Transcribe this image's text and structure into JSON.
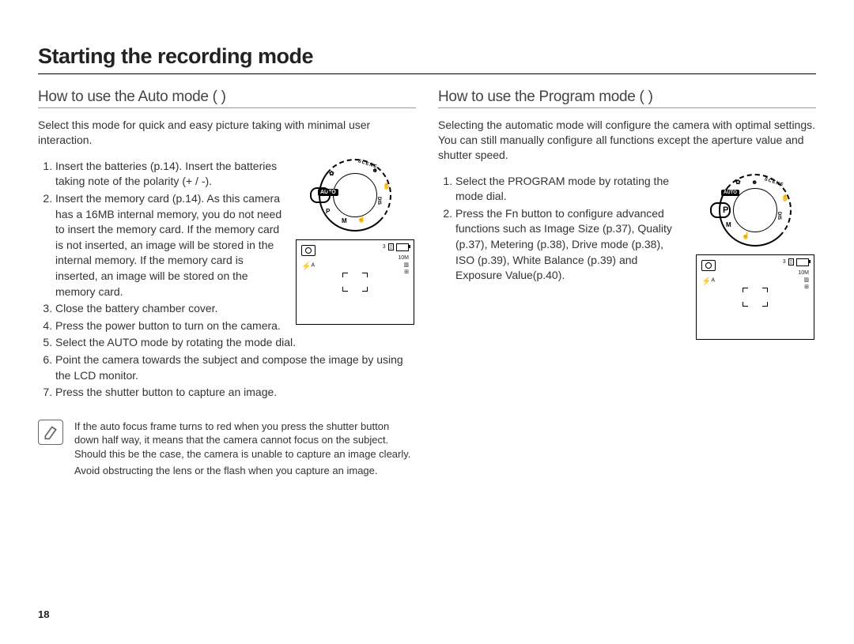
{
  "title": "Starting the recording mode",
  "page_number": "18",
  "left": {
    "heading": "How to use the Auto mode (          )",
    "intro": "Select this mode for quick and easy picture taking with minimal user interaction.",
    "steps": [
      "Insert the batteries (p.14). Insert the batteries taking note of the polarity (+ / -).",
      "Insert the memory card (p.14). As this camera has a 16MB internal memory, you do not need to insert the memory card. If the memory card is not inserted, an image will be stored in the internal memory. If the memory card is inserted, an image will be stored on the memory card.",
      "Close the battery chamber cover.",
      "Press the power button to turn on the camera.",
      "Select the AUTO mode by rotating the mode dial.",
      "Point the camera towards the subject and compose the image by using the LCD monitor.",
      "Press the shutter button to capture an image."
    ],
    "dial_selected": "AUTO",
    "dial_labels": {
      "scene": "SCENE",
      "p": "P",
      "m": "M",
      "dis": "DIS"
    },
    "lcd": {
      "top_right_count": "3",
      "resolution": "10M",
      "flash_auto": "⚡ᴬ"
    },
    "note": [
      "If the auto focus frame turns to red when you press the shutter button down half way, it means that the camera cannot focus on the subject. Should this be the case, the camera is unable to capture an image clearly.",
      "Avoid obstructing the lens or the ﬂash when you capture an image."
    ]
  },
  "right": {
    "heading": "How to use the Program mode (     )",
    "intro": "Selecting the automatic mode will conﬁgure the camera with optimal settings. You can still manually conﬁgure all functions except the aperture value and shutter speed.",
    "steps": [
      "Select the PROGRAM mode by rotating the mode dial.",
      "Press the Fn button to conﬁgure advanced functions such as Image Size (p.37), Quality (p.37), Metering (p.38), Drive mode (p.38), ISO (p.39), White Balance (p.39) and Exposure Value(p.40)."
    ],
    "dial_selected": "P",
    "dial_labels": {
      "scene": "SCENE",
      "auto": "AUTO",
      "m": "M",
      "dis": "DIS"
    },
    "lcd": {
      "top_right_count": "3",
      "resolution": "10M",
      "flash_auto": "⚡ᴬ"
    }
  }
}
